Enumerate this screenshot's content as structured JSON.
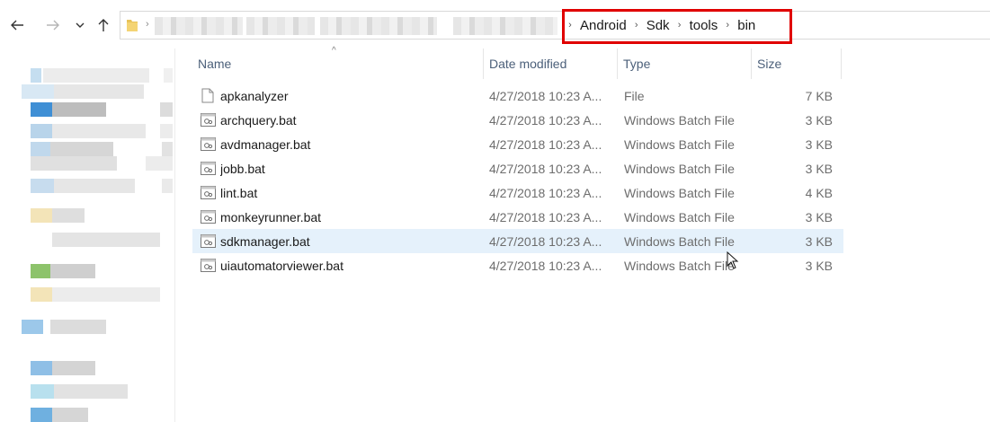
{
  "nav": {
    "back_icon": "back-arrow-icon",
    "forward_icon": "forward-arrow-icon",
    "recent_icon": "chevron-down-icon",
    "up_icon": "up-arrow-icon"
  },
  "address_bar": {
    "folder_icon": "folder-icon",
    "breadcrumbs": [
      "Android",
      "Sdk",
      "tools",
      "bin"
    ]
  },
  "columns": {
    "name": "Name",
    "date_modified": "Date modified",
    "type": "Type",
    "size": "Size"
  },
  "files": [
    {
      "name": "apkanalyzer",
      "date": "4/27/2018 10:23 A...",
      "type": "File",
      "size": "7 KB",
      "icon": "generic-file-icon"
    },
    {
      "name": "archquery.bat",
      "date": "4/27/2018 10:23 A...",
      "type": "Windows Batch File",
      "size": "3 KB",
      "icon": "batch-file-icon"
    },
    {
      "name": "avdmanager.bat",
      "date": "4/27/2018 10:23 A...",
      "type": "Windows Batch File",
      "size": "3 KB",
      "icon": "batch-file-icon"
    },
    {
      "name": "jobb.bat",
      "date": "4/27/2018 10:23 A...",
      "type": "Windows Batch File",
      "size": "3 KB",
      "icon": "batch-file-icon"
    },
    {
      "name": "lint.bat",
      "date": "4/27/2018 10:23 A...",
      "type": "Windows Batch File",
      "size": "4 KB",
      "icon": "batch-file-icon"
    },
    {
      "name": "monkeyrunner.bat",
      "date": "4/27/2018 10:23 A...",
      "type": "Windows Batch File",
      "size": "3 KB",
      "icon": "batch-file-icon"
    },
    {
      "name": "sdkmanager.bat",
      "date": "4/27/2018 10:23 A...",
      "type": "Windows Batch File",
      "size": "3 KB",
      "icon": "batch-file-icon"
    },
    {
      "name": "uiautomatorviewer.bat",
      "date": "4/27/2018 10:23 A...",
      "type": "Windows Batch File",
      "size": "3 KB",
      "icon": "batch-file-icon"
    }
  ],
  "selected_row": 6,
  "colors": {
    "highlight_box": "#e00000",
    "selected_row": "#e5f1fb",
    "header_text": "#4c607a"
  }
}
